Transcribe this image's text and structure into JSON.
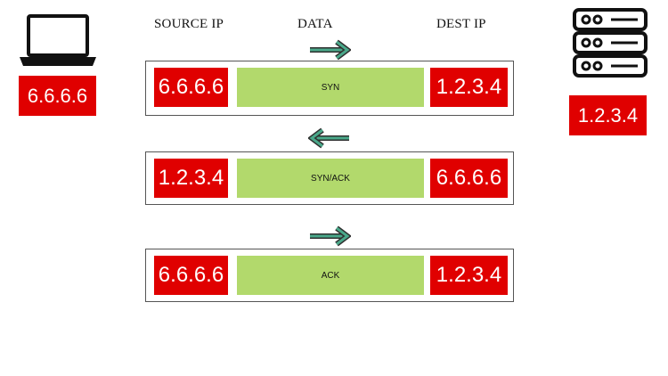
{
  "headers": {
    "source": "SOURCE IP",
    "data": "DATA",
    "dest": "DEST IP"
  },
  "client": {
    "icon": "laptop-icon",
    "ip": "6.6.6.6"
  },
  "server": {
    "icon": "server-rack-icon",
    "ip": "1.2.3.4"
  },
  "packets": [
    {
      "source": "6.6.6.6",
      "data": "SYN",
      "dest": "1.2.3.4",
      "direction": "right"
    },
    {
      "source": "1.2.3.4",
      "data": "SYN/ACK",
      "dest": "6.6.6.6",
      "direction": "left"
    },
    {
      "source": "6.6.6.6",
      "data": "ACK",
      "dest": "1.2.3.4",
      "direction": "right"
    }
  ],
  "colors": {
    "ip_box": "#e00000",
    "data_field": "#b2d96c",
    "arrow": "#4aa88a"
  }
}
